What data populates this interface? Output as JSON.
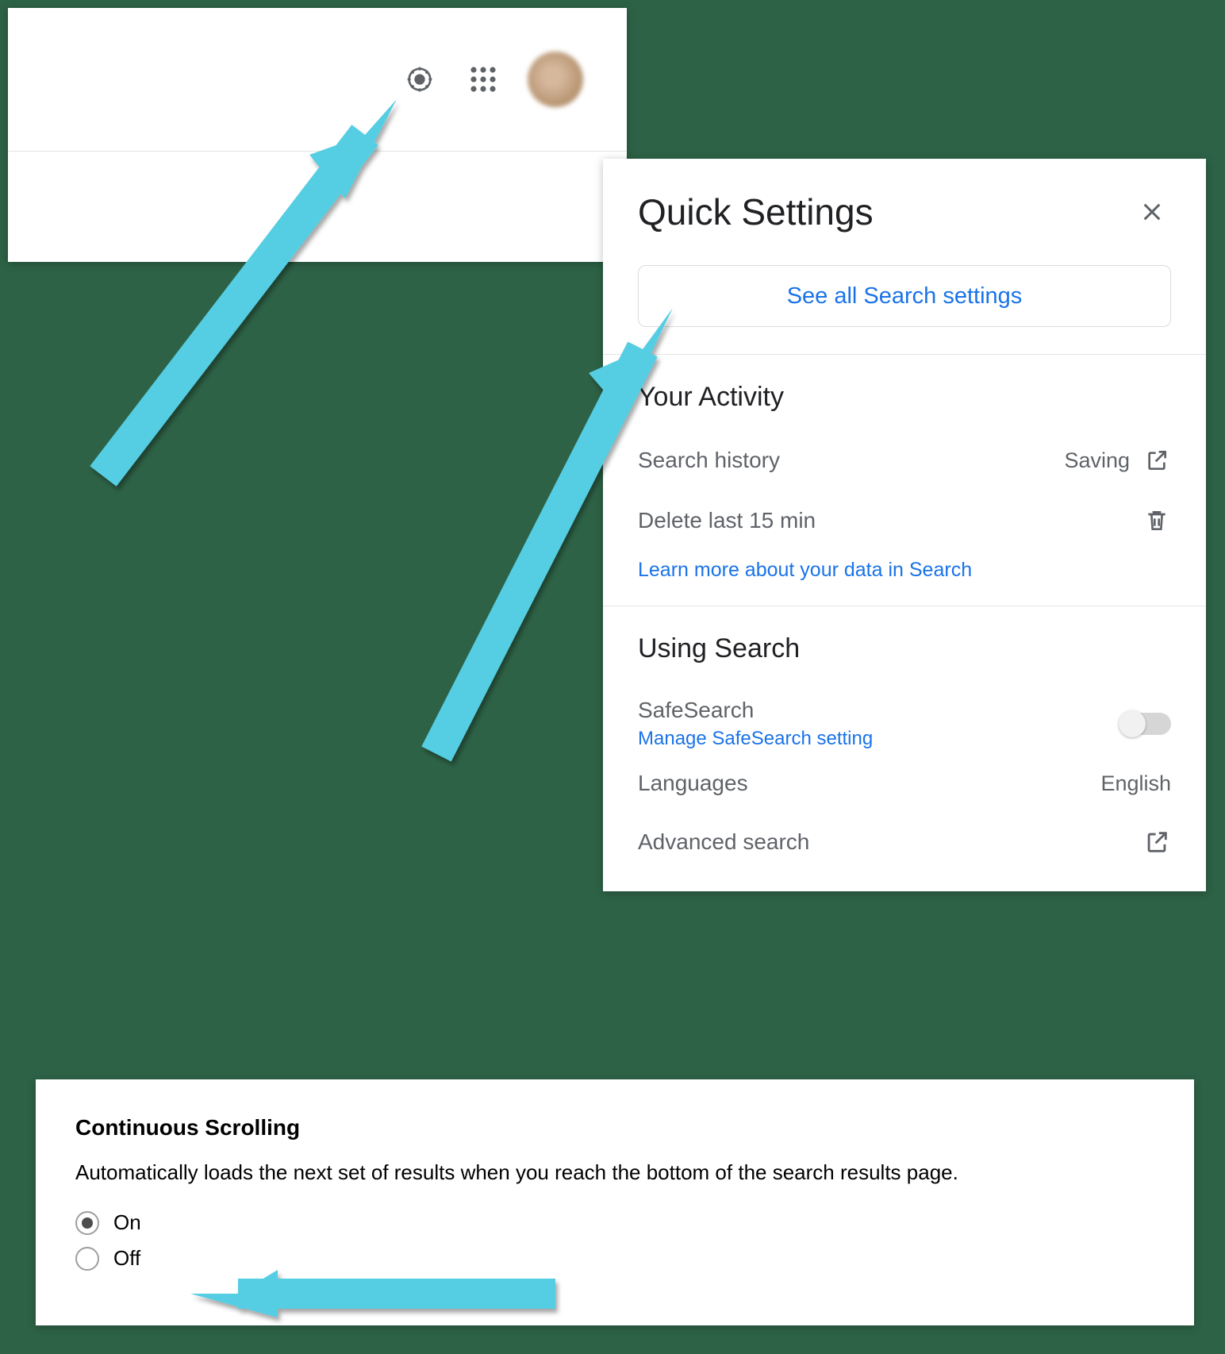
{
  "header": {
    "icons": {
      "gear": "gear-icon",
      "apps": "apps-icon",
      "avatar": "avatar"
    }
  },
  "quick_settings": {
    "title": "Quick Settings",
    "see_all_label": "See all Search settings",
    "sections": {
      "activity": {
        "title": "Your Activity",
        "search_history": {
          "label": "Search history",
          "status": "Saving"
        },
        "delete_15": {
          "label": "Delete last 15 min"
        },
        "learn_more": "Learn more about your data in Search"
      },
      "using": {
        "title": "Using Search",
        "safesearch": {
          "label": "SafeSearch",
          "manage": "Manage SafeSearch setting"
        },
        "languages": {
          "label": "Languages",
          "value": "English"
        },
        "advanced": {
          "label": "Advanced search"
        }
      }
    }
  },
  "continuous": {
    "title": "Continuous Scrolling",
    "desc": "Automatically loads the next set of results when you reach the bottom of the search results page.",
    "on": "On",
    "off": "Off"
  }
}
